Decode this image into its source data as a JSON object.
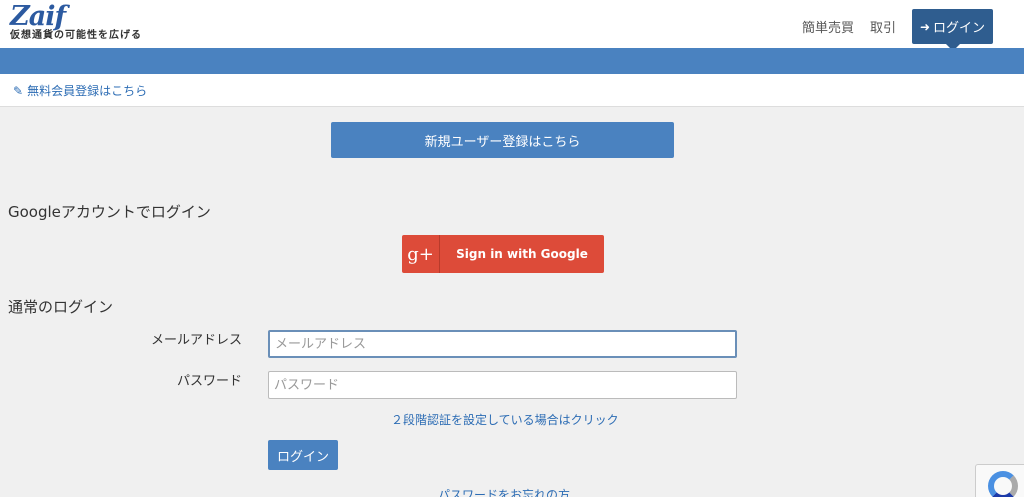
{
  "header": {
    "logo_mark": "Zaif",
    "logo_tagline": "仮想通貨の可能性を広げる",
    "nav": {
      "simple_trade": "簡単売買",
      "trade": "取引",
      "login": "ログイン"
    }
  },
  "subbar": {
    "register_link": "無料会員登録はこちら"
  },
  "main": {
    "new_user_button": "新規ユーザー登録はこちら",
    "google_section_title": "Googleアカウントでログイン",
    "google_button": "Sign in with Google",
    "normal_section_title": "通常のログイン",
    "email_label": "メールアドレス",
    "email_placeholder": "メールアドレス",
    "password_label": "パスワード",
    "password_placeholder": "パスワード",
    "twofa_link": "２段階認証を設定している場合はクリック",
    "login_button": "ログイン",
    "forgot_link": "パスワードをお忘れの方"
  },
  "colors": {
    "primary": "#4a82c0",
    "nav_active": "#2f5d8f",
    "google": "#dd4b39",
    "link": "#2c6cb4"
  },
  "icons": {
    "login": "sign-in-icon",
    "register": "pencil-icon",
    "google": "google-plus-icon",
    "captcha": "recaptcha-icon"
  }
}
